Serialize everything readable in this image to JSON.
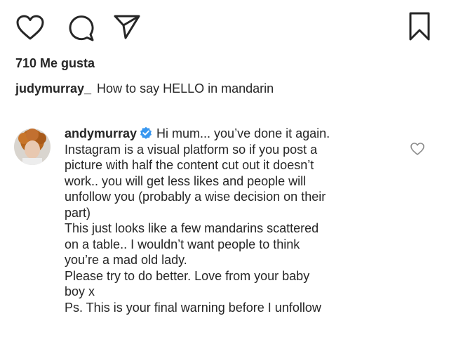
{
  "actions": {
    "like_icon": "heart-icon",
    "comment_icon": "comment-icon",
    "share_icon": "send-icon",
    "save_icon": "bookmark-icon"
  },
  "likes": {
    "count_label": "710 Me gusta"
  },
  "caption": {
    "username": "judymurray_",
    "text": "How to say HELLO in mandarin"
  },
  "comment": {
    "username": "andymurray",
    "verified": true,
    "verified_color": "#3897f0",
    "first_line": "Hi mum... you’ve done it again.",
    "lines": [
      "Instagram is a visual platform so if you post a",
      "picture with half the content cut out it doesn’t",
      "work.. you will get less likes and people will",
      "unfollow you (probably a wise decision on their",
      "part)",
      "This just looks like a few mandarins scattered",
      "on a table.. I wouldn’t want people to think",
      "you’re a mad old lady.",
      "Please try to do better. Love from your baby",
      "boy x",
      "Ps. This is your final warning before I unfollow"
    ],
    "like_icon": "heart-outline-icon"
  }
}
